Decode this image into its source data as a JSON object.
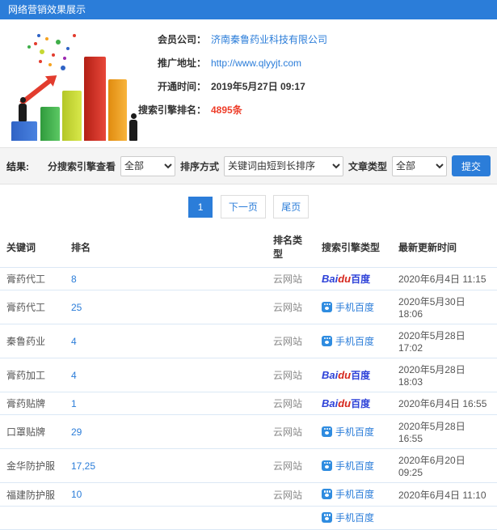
{
  "colors": {
    "accent": "#2b7dd9",
    "red": "#ee3c28",
    "baidu_blue": "#2d41d8",
    "baidu_red": "#d6281e",
    "header_bg": "#2b7dd9"
  },
  "header": {
    "title": "网络营销效果展示"
  },
  "info": {
    "illustration": "3d-bar-chart-growth-clipart",
    "fields": [
      {
        "label": "会员公司：",
        "value": "济南秦鲁药业科技有限公司"
      },
      {
        "label": "推广地址：",
        "value": "http://www.qlyyjt.com"
      },
      {
        "label": "开通时间：",
        "value": "2019年5月27日 09:17"
      },
      {
        "label": "搜索引擎排名：",
        "value": "4895条"
      }
    ]
  },
  "filters": {
    "result_label": "结果:",
    "engine_label": "分搜索引擎查看",
    "engine_value": "全部",
    "sort_label": "排序方式",
    "sort_value": "关键词由短到长排序",
    "article_label": "文章类型",
    "article_value": "全部",
    "submit_label": "提交"
  },
  "pagination": {
    "current": "1",
    "next": "下一页",
    "last": "尾页"
  },
  "table": {
    "headers": [
      "关键词",
      "排名",
      "排名类型",
      "搜索引擎类型",
      "最新更新时间"
    ],
    "rows": [
      {
        "keyword": "膏药代工",
        "rank": "8",
        "rank_type": "云网站",
        "engine": "baidu",
        "time": "2020年6月4日 11:15"
      },
      {
        "keyword": "膏药代工",
        "rank": "25",
        "rank_type": "云网站",
        "engine": "mobile",
        "time": "2020年5月30日 18:06"
      },
      {
        "keyword": "秦鲁药业",
        "rank": "4",
        "rank_type": "云网站",
        "engine": "mobile",
        "time": "2020年5月28日 17:02"
      },
      {
        "keyword": "膏药加工",
        "rank": "4",
        "rank_type": "云网站",
        "engine": "baidu",
        "time": "2020年5月28日 18:03"
      },
      {
        "keyword": "膏药贴牌",
        "rank": "1",
        "rank_type": "云网站",
        "engine": "baidu",
        "time": "2020年6月4日 16:55"
      },
      {
        "keyword": "口罩贴牌",
        "rank": "29",
        "rank_type": "云网站",
        "engine": "mobile",
        "time": "2020年5月28日 16:55"
      },
      {
        "keyword": "金华防护服",
        "rank": "17,25",
        "rank_type": "云网站",
        "engine": "mobile",
        "time": "2020年6月20日 09:25"
      },
      {
        "keyword": "福建防护服",
        "rank": "10",
        "rank_type": "云网站",
        "engine": "mobile",
        "time": "2020年6月4日 11:10"
      },
      {
        "keyword": "",
        "rank": "",
        "rank_type": "",
        "engine": "mobile",
        "time": ""
      }
    ]
  },
  "engines": {
    "baidu": {
      "bai": "Bai",
      "du": "du",
      "cn": "百度"
    },
    "mobile": {
      "label": "手机百度"
    }
  }
}
